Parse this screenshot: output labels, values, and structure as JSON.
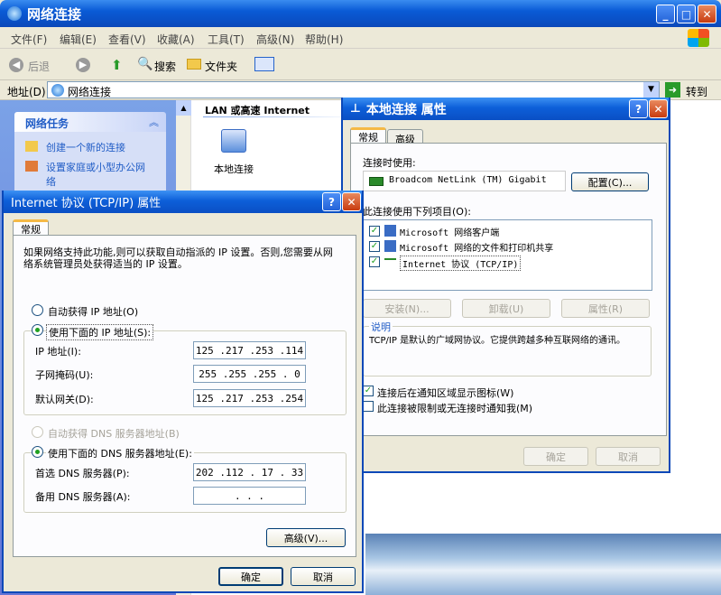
{
  "window": {
    "title": "网络连接"
  },
  "menu": [
    "文件(F)",
    "编辑(E)",
    "查看(V)",
    "收藏(A)",
    "工具(T)",
    "高级(N)",
    "帮助(H)"
  ],
  "toolbar": {
    "back": "后退",
    "search": "搜索",
    "folders": "文件夹"
  },
  "address": {
    "label": "地址(D)",
    "value": "网络连接",
    "go": "转到"
  },
  "tasks": {
    "title": "网络任务",
    "items": [
      "创建一个新的连接",
      "设置家庭或小型办公网络"
    ]
  },
  "content": {
    "header": "LAN 或高速 Internet",
    "item": "本地连接"
  },
  "props": {
    "title": "本地连接 属性",
    "tabs": [
      "常规",
      "高级"
    ],
    "connect_using": "连接时使用:",
    "adapter": "Broadcom NetLink (TM) Gigabit",
    "config_btn": "配置(C)...",
    "items_label": "此连接使用下列项目(O):",
    "items": [
      "Microsoft 网络客户端",
      "Microsoft 网络的文件和打印机共享",
      "Internet 协议 (TCP/IP)"
    ],
    "install": "安装(N)...",
    "uninstall": "卸载(U)",
    "properties": "属性(R)",
    "desc_label": "说明",
    "desc": "TCP/IP 是默认的广域网协议。它提供跨越多种互联网络的通讯。",
    "notify": "连接后在通知区域显示图标(W)",
    "notify_limited": "此连接被限制或无连接时通知我(M)",
    "ok": "确定",
    "cancel": "取消"
  },
  "tcpip": {
    "title": "Internet 协议 (TCP/IP) 属性",
    "tab": "常规",
    "intro": "如果网络支持此功能,则可以获取自动指派的 IP 设置。否则,您需要从网络系统管理员处获得适当的 IP 设置。",
    "auto_ip": "自动获得 IP 地址(O)",
    "manual_ip": "使用下面的 IP 地址(S):",
    "ip_label": "IP 地址(I):",
    "ip": "125 .217 .253 .114",
    "mask_label": "子网掩码(U):",
    "mask": "255 .255 .255 . 0",
    "gw_label": "默认网关(D):",
    "gw": "125 .217 .253 .254",
    "auto_dns": "自动获得 DNS 服务器地址(B)",
    "manual_dns": "使用下面的 DNS 服务器地址(E):",
    "dns1_label": "首选 DNS 服务器(P):",
    "dns1": "202 .112 . 17 . 33",
    "dns2_label": "备用 DNS 服务器(A):",
    "dns2": ".   .   .",
    "advanced": "高级(V)...",
    "ok": "确定",
    "cancel": "取消"
  }
}
